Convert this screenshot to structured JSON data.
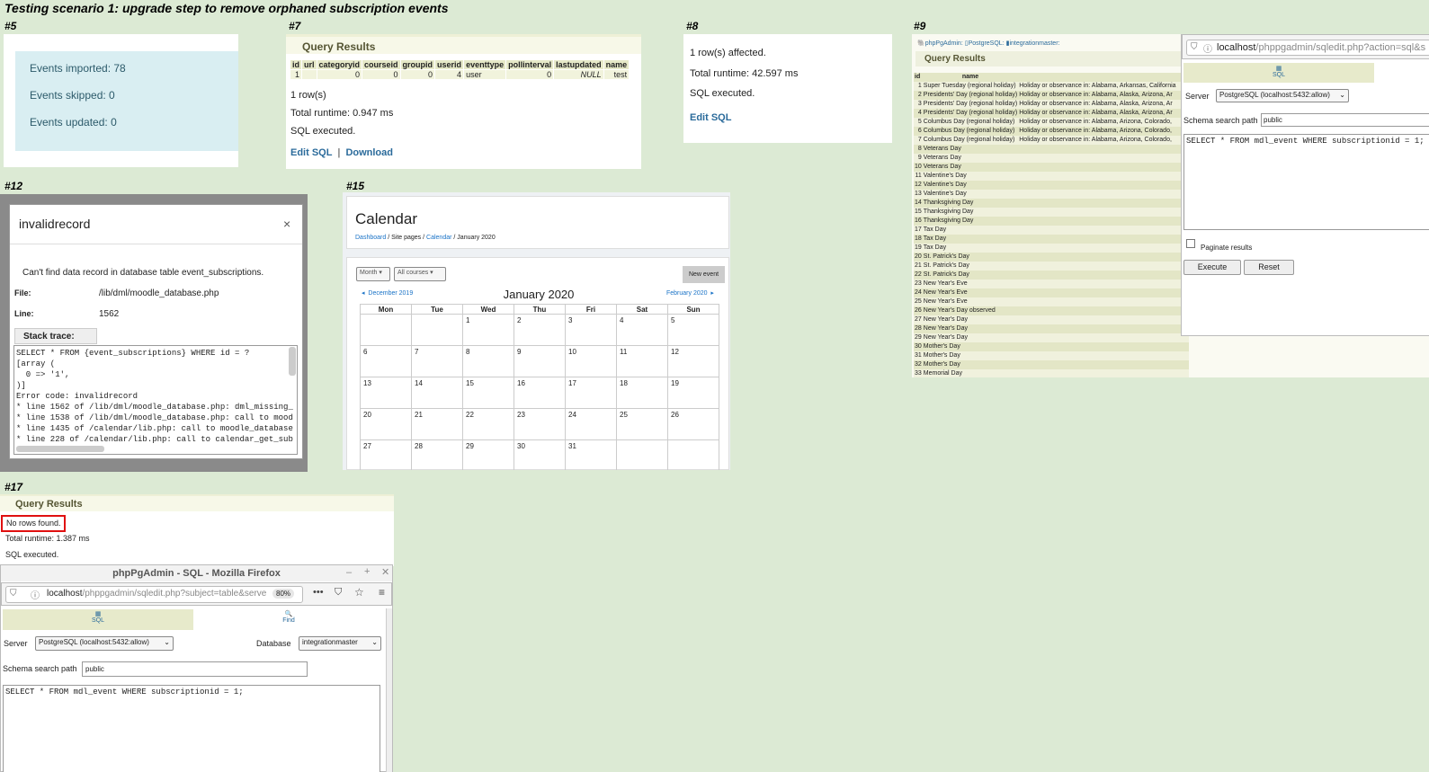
{
  "title": "Testing scenario 1: upgrade step to remove orphaned subscription events",
  "panels": {
    "p5": {
      "label": "#5",
      "events": [
        "Events imported: 78",
        "Events skipped: 0",
        "Events updated: 0"
      ]
    },
    "p7": {
      "label": "#7",
      "heading": "Query Results",
      "columns": [
        "id",
        "url",
        "categoryid",
        "courseid",
        "groupid",
        "userid",
        "eventtype",
        "pollinterval",
        "lastupdated",
        "name"
      ],
      "row": [
        "1",
        "",
        "0",
        "0",
        "0",
        "4",
        "user",
        "0",
        "NULL",
        "test"
      ],
      "rows": "1 row(s)",
      "runtime": "Total runtime: 0.947 ms",
      "status": "SQL executed.",
      "edit_sql": "Edit SQL",
      "download": "Download"
    },
    "p8": {
      "label": "#8",
      "affected": "1 row(s) affected.",
      "runtime": "Total runtime: 42.597 ms",
      "status": "SQL executed.",
      "edit_sql": "Edit SQL"
    },
    "p9": {
      "label": "#9",
      "breadcrumb": [
        "phpPgAdmin",
        "PostgreSQL",
        "integrationmaster"
      ],
      "heading": "Query Results",
      "col_id": "id",
      "col_name": "name",
      "rows": [
        {
          "id": "1",
          "name": "Super Tuesday (regional holiday)",
          "desc": "Holiday or observance in: Alabama, Arkansas, California"
        },
        {
          "id": "2",
          "name": "Presidents' Day (regional holiday)",
          "desc": "Holiday or observance in: Alabama, Alaska, Arizona, Ar"
        },
        {
          "id": "3",
          "name": "Presidents' Day (regional holiday)",
          "desc": "Holiday or observance in: Alabama, Alaska, Arizona, Ar"
        },
        {
          "id": "4",
          "name": "Presidents' Day (regional holiday)",
          "desc": "Holiday or observance in: Alabama, Alaska, Arizona, Ar"
        },
        {
          "id": "5",
          "name": "Columbus Day (regional holiday)",
          "desc": "Holiday or observance in: Alabama, Arizona, Colorado,"
        },
        {
          "id": "6",
          "name": "Columbus Day (regional holiday)",
          "desc": "Holiday or observance in: Alabama, Arizona, Colorado,"
        },
        {
          "id": "7",
          "name": "Columbus Day (regional holiday)",
          "desc": "Holiday or observance in: Alabama, Arizona, Colorado,"
        },
        {
          "id": "8",
          "name": "Veterans Day",
          "desc": ""
        },
        {
          "id": "9",
          "name": "Veterans Day",
          "desc": ""
        },
        {
          "id": "10",
          "name": "Veterans Day",
          "desc": ""
        },
        {
          "id": "11",
          "name": "Valentine's Day",
          "desc": ""
        },
        {
          "id": "12",
          "name": "Valentine's Day",
          "desc": ""
        },
        {
          "id": "13",
          "name": "Valentine's Day",
          "desc": ""
        },
        {
          "id": "14",
          "name": "Thanksgiving Day",
          "desc": ""
        },
        {
          "id": "15",
          "name": "Thanksgiving Day",
          "desc": ""
        },
        {
          "id": "16",
          "name": "Thanksgiving Day",
          "desc": ""
        },
        {
          "id": "17",
          "name": "Tax Day",
          "desc": ""
        },
        {
          "id": "18",
          "name": "Tax Day",
          "desc": ""
        },
        {
          "id": "19",
          "name": "Tax Day",
          "desc": ""
        },
        {
          "id": "20",
          "name": "St. Patrick's Day",
          "desc": ""
        },
        {
          "id": "21",
          "name": "St. Patrick's Day",
          "desc": ""
        },
        {
          "id": "22",
          "name": "St. Patrick's Day",
          "desc": ""
        },
        {
          "id": "23",
          "name": "New Year's Eve",
          "desc": ""
        },
        {
          "id": "24",
          "name": "New Year's Eve",
          "desc": ""
        },
        {
          "id": "25",
          "name": "New Year's Eve",
          "desc": ""
        },
        {
          "id": "26",
          "name": "New Year's Day observed",
          "desc": ""
        },
        {
          "id": "27",
          "name": "New Year's Day",
          "desc": ""
        },
        {
          "id": "28",
          "name": "New Year's Day",
          "desc": ""
        },
        {
          "id": "29",
          "name": "New Year's Day",
          "desc": ""
        },
        {
          "id": "30",
          "name": "Mother's Day",
          "desc": ""
        },
        {
          "id": "31",
          "name": "Mother's Day",
          "desc": ""
        },
        {
          "id": "32",
          "name": "Mother's Day",
          "desc": ""
        },
        {
          "id": "33",
          "name": "Memorial Day",
          "desc": ""
        }
      ],
      "popup": {
        "url_host": "localhost",
        "url_path": "/phppgadmin/sqledit.php?action=sql&s",
        "tab_sql": "SQL",
        "server_label": "Server",
        "server_value": "PostgreSQL (localhost:5432:allow)",
        "schema_label": "Schema search path",
        "schema_value": "public",
        "sql": "SELECT * FROM mdl_event WHERE subscriptionid = 1;",
        "paginate": "Paginate results",
        "execute": "Execute",
        "reset": "Reset"
      }
    },
    "p12": {
      "label": "#12",
      "modal_title": "invalidrecord",
      "close": "×",
      "message": "Can't find data record in database table event_subscriptions.",
      "file_label": "File:",
      "file_value": "/lib/dml/moodle_database.php",
      "line_label": "Line:",
      "line_value": "1562",
      "stack_label": "Stack trace:",
      "stack": "SELECT * FROM {event_subscriptions} WHERE id = ?\n[array (\n  0 => '1',\n)]\nError code: invalidrecord\n* line 1562 of /lib/dml/moodle_database.php: dml_missing_\n* line 1538 of /lib/dml/moodle_database.php: call to mood\n* line 1435 of /calendar/lib.php: call to moodle_database\n* line 228 of /calendar/lib.php: call to calendar_get_sub"
    },
    "p15": {
      "label": "#15",
      "heading": "Calendar",
      "breadcrumb": [
        "Dashboard",
        "Site pages",
        "Calendar",
        "January 2020"
      ],
      "view_select": "Month",
      "course_select": "All courses",
      "new_event": "New event",
      "prev": "December 2019",
      "next": "February 2020",
      "month": "January 2020",
      "weekdays": [
        "Mon",
        "Tue",
        "Wed",
        "Thu",
        "Fri",
        "Sat",
        "Sun"
      ],
      "weeks": [
        [
          "",
          "",
          "1",
          "2",
          "3",
          "4",
          "5"
        ],
        [
          "6",
          "7",
          "8",
          "9",
          "10",
          "11",
          "12"
        ],
        [
          "13",
          "14",
          "15",
          "16",
          "17",
          "18",
          "19"
        ],
        [
          "20",
          "21",
          "22",
          "23",
          "24",
          "25",
          "26"
        ],
        [
          "27",
          "28",
          "29",
          "30",
          "31",
          "",
          ""
        ]
      ]
    },
    "p17": {
      "label": "#17",
      "heading": "Query Results",
      "no_rows": "No rows found.",
      "runtime": "Total runtime: 1.387 ms",
      "status": "SQL executed.",
      "window_title": "phpPgAdmin - SQL - Mozilla Firefox",
      "url_host": "localhost",
      "url_path": "/phppgadmin/sqledit.php?subject=table&serve",
      "zoom": "80%",
      "tab_sql": "SQL",
      "tab_find": "Find",
      "server_label": "Server",
      "server_value": "PostgreSQL (localhost:5432:allow)",
      "database_label": "Database",
      "database_value": "integrationmaster",
      "schema_label": "Schema search path",
      "schema_value": "public",
      "sql": "SELECT * FROM mdl_event WHERE subscriptionid = 1;"
    }
  },
  "colors": {
    "background": "#dcead4",
    "link": "#2b6b9b",
    "highlight_box": "#e01010"
  }
}
